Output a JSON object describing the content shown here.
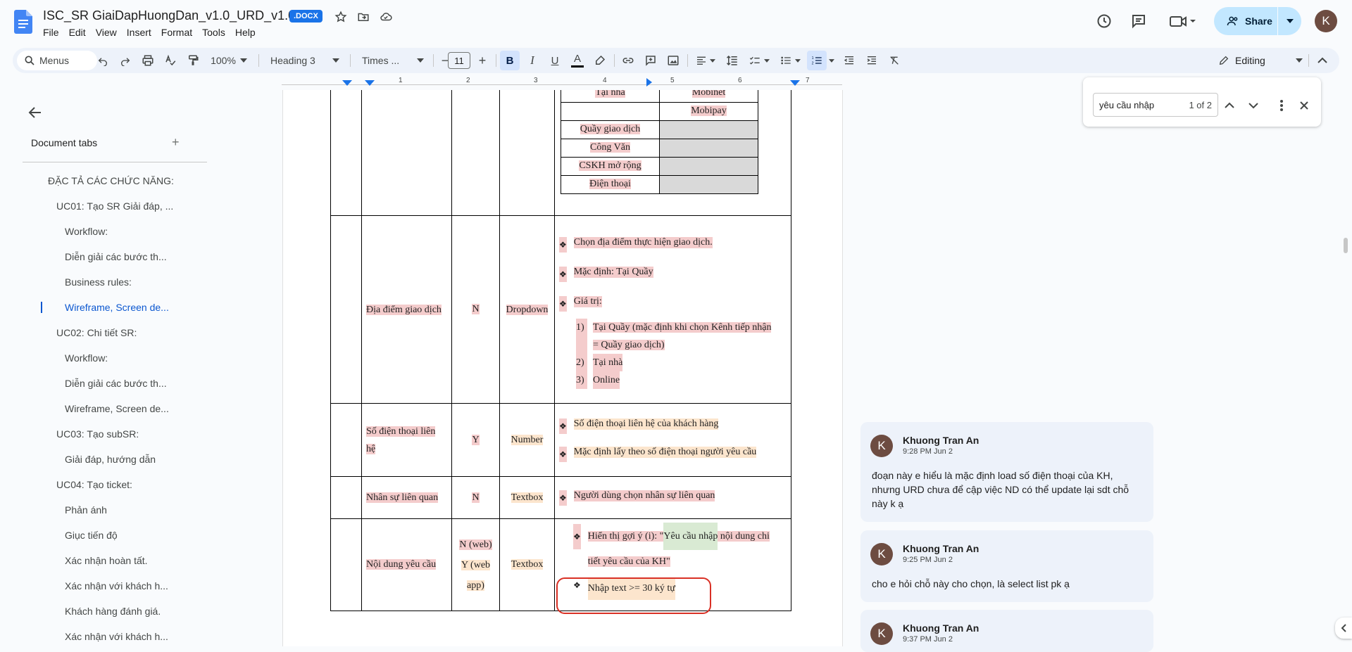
{
  "doc": {
    "title": "ISC_SR GiaiDapHuongDan_v1.0_URD_v1.0",
    "badge": ".DOCX",
    "brand_color": "#1a73e8"
  },
  "menu": [
    "File",
    "Edit",
    "View",
    "Insert",
    "Format",
    "Tools",
    "Help"
  ],
  "header": {
    "share_label": "Share",
    "avatar_letter": "K"
  },
  "toolbar": {
    "menus_label": "Menus",
    "zoom": "100%",
    "style": "Heading 3",
    "font": "Times ...",
    "font_size": "11",
    "editing_label": "Editing"
  },
  "left_panel": {
    "tabs_title": "Document tabs",
    "add_symbol": "+",
    "outline": [
      {
        "label": "ĐẶC TẢ CÁC CHỨC NĂNG:",
        "level": 0
      },
      {
        "label": "UC01: Tạo SR Giải đáp, ...",
        "level": 1
      },
      {
        "label": "Workflow:",
        "level": 2
      },
      {
        "label": "Diễn giải các bước th...",
        "level": 2
      },
      {
        "label": "Business rules:",
        "level": 2
      },
      {
        "label": "Wireframe, Screen de...",
        "level": 2,
        "active": true
      },
      {
        "label": "UC02: Chi tiết SR:",
        "level": 1
      },
      {
        "label": "Workflow:",
        "level": 2
      },
      {
        "label": "Diễn giải các bước th...",
        "level": 2
      },
      {
        "label": "Wireframe, Screen de...",
        "level": 2
      },
      {
        "label": "UC03: Tạo subSR:",
        "level": 1
      },
      {
        "label": "Giải đáp, hướng dẫn",
        "level": 2
      },
      {
        "label": "UC04: Tạo ticket:",
        "level": 1
      },
      {
        "label": "Phản ánh",
        "level": 2
      },
      {
        "label": "Giục tiến độ",
        "level": 2
      },
      {
        "label": "Xác nhận hoàn tất.",
        "level": 2
      },
      {
        "label": "Xác nhận với khách h...",
        "level": 2
      },
      {
        "label": "Khách hàng đánh giá.",
        "level": 2
      },
      {
        "label": "Xác nhận với khách h...",
        "level": 2
      }
    ]
  },
  "ruler": [
    "1",
    "2",
    "3",
    "4",
    "5",
    "6",
    "7"
  ],
  "table": {
    "inner": {
      "tai_nha": "Tại nhà",
      "mobinet": "Mobinet",
      "mobipay": "Mobipay",
      "quay": "Quầy giao dịch",
      "cong_van": "Công Văn",
      "cskh": "CSKH mở rộng",
      "dien_thoai": "Điện thoại"
    },
    "row_dia_diem": {
      "name": "Địa điểm giao dịch",
      "required": "N",
      "type": "Dropdown",
      "b1": "Chọn địa điểm thực hiện giao dịch.",
      "b2": "Mặc định: Tại Quầy",
      "b3": "Giá trị:",
      "n1a": "Tại Quầy (mặc định khi chọn Kênh tiếp nhận",
      "n1b": "= Quầy giao dịch)",
      "n2": "Tại nhà",
      "n3": "Online"
    },
    "row_sdt": {
      "name": "Số điện thoại liên hệ",
      "required": "Y",
      "type": "Number",
      "b1": "Số điện thoại liên hệ của khách hàng",
      "b2": "Mặc định lấy theo số điện thoại người yêu cầu"
    },
    "row_nhan_su": {
      "name": "Nhân sự liên quan",
      "required": "N",
      "type": "Textbox",
      "b1": "Người dùng chọn nhân sự liên quan"
    },
    "row_noi_dung": {
      "name": "Nội dung yêu cầu",
      "required_a": "N (web)",
      "required_b": "Y (web",
      "required_c": "app)",
      "type": "Textbox",
      "b1_prefix": "Hiển thị gợi ý (i): \"",
      "b1_match": "Yêu cầu nhập",
      "b1_suffix": " nội dung chi",
      "b1_line2": "tiết yêu cầu của KH\"",
      "b2": "Nhập text >= 30 ký tự"
    }
  },
  "find": {
    "query": "yêu cầu nhập",
    "count": "1 of 2"
  },
  "comments": [
    {
      "avatar": "K",
      "author": "Khuong Tran An",
      "time": "9:28 PM Jun 2",
      "text": "đoạn này e hiểu là mặc định load số điện thoại của KH, nhưng URD chưa để cập việc ND có thể update lại sdt chỗ này k ạ"
    },
    {
      "avatar": "K",
      "author": "Khuong Tran An",
      "time": "9:25 PM Jun 2",
      "text": "cho e hỏi chỗ này cho chọn, là select list pk ạ"
    },
    {
      "avatar": "K",
      "author": "Khuong Tran An",
      "time": "9:37 PM Jun 2",
      "text": ""
    }
  ]
}
